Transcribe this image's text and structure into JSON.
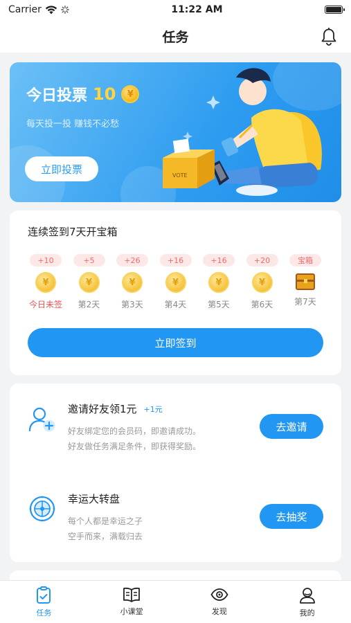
{
  "status_bar": {
    "carrier": "Carrier",
    "time": "11:22 AM"
  },
  "navbar": {
    "title": "任务",
    "bell_icon": "bell-icon"
  },
  "banner": {
    "title": "今日投票",
    "count": "10",
    "coin_symbol": "¥",
    "subtitle": "每天投一投  赚钱不必愁",
    "button_label": "立即投票",
    "box_label": "VOTE"
  },
  "signin": {
    "title": "连续签到7天开宝箱",
    "days": [
      {
        "reward": "+10",
        "label": "今日未签",
        "type": "coin",
        "today": true
      },
      {
        "reward": "+5",
        "label": "第2天",
        "type": "coin",
        "today": false
      },
      {
        "reward": "+26",
        "label": "第3天",
        "type": "coin",
        "today": false
      },
      {
        "reward": "+16",
        "label": "第4天",
        "type": "coin",
        "today": false
      },
      {
        "reward": "+16",
        "label": "第5天",
        "type": "coin",
        "today": false
      },
      {
        "reward": "+20",
        "label": "第6天",
        "type": "coin",
        "today": false
      },
      {
        "reward": "宝箱",
        "label": "第7天",
        "type": "chest",
        "today": false
      }
    ],
    "coin_symbol": "¥",
    "button_label": "立即签到"
  },
  "tasks": [
    {
      "icon": "invite-user-icon",
      "name": "邀请好友领1元",
      "badge": "+1元",
      "desc1": "好友绑定您的会员码，即邀请成功。",
      "desc2": "好友做任务满足条件，即获得奖励。",
      "button_label": "去邀请"
    },
    {
      "icon": "lucky-wheel-icon",
      "name": "幸运大转盘",
      "badge": "",
      "desc1": "每个人都是幸运之子",
      "desc2": "空手而来，满载归去",
      "button_label": "去抽奖"
    }
  ],
  "tabbar": [
    {
      "label": "任务",
      "icon": "task-icon",
      "active": true
    },
    {
      "label": "小课堂",
      "icon": "book-icon",
      "active": false
    },
    {
      "label": "发现",
      "icon": "eye-icon",
      "active": false
    },
    {
      "label": "我的",
      "icon": "user-icon",
      "active": false
    }
  ],
  "colors": {
    "accent": "#2196f3",
    "reward_red": "#f06a6a",
    "banner_from": "#6cc0f6",
    "banner_to": "#1e8ee8",
    "gold": "#f6b817"
  }
}
